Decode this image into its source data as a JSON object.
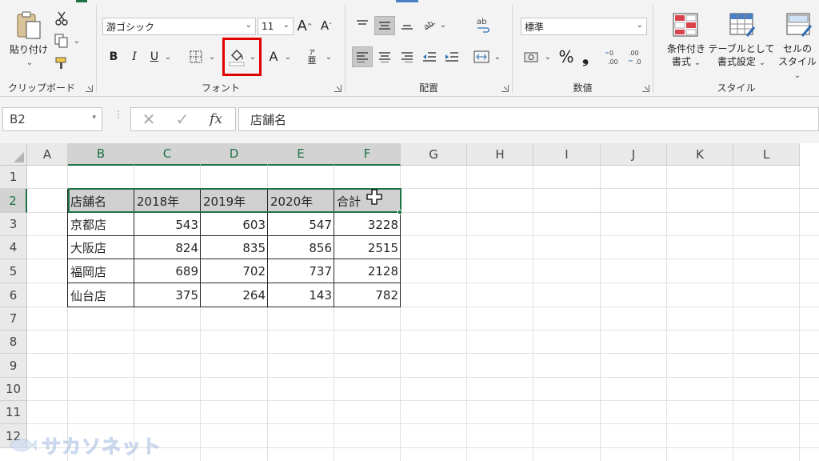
{
  "ribbon": {
    "clipboard": {
      "label": "クリップボード",
      "paste_label": "貼り付け"
    },
    "font": {
      "label": "フォント",
      "font_name": "游ゴシック",
      "font_size": "11",
      "bold": "B",
      "italic": "I",
      "underline": "U",
      "font_color": "A",
      "phonetic_top": "ア",
      "phonetic_bottom": "亜",
      "grow": "A",
      "shrink": "A",
      "highlight_color": "#e00000"
    },
    "alignment": {
      "label": "配置"
    },
    "number": {
      "label": "数値",
      "format": "標準",
      "percent": "%",
      "comma": "❟"
    },
    "styles": {
      "label": "スタイル",
      "conditional_line1": "条件付き",
      "conditional_line2": "書式",
      "table_line1": "テーブルとして",
      "table_line2": "書式設定",
      "cell_line1": "セルの",
      "cell_line2": "スタイル"
    }
  },
  "formula_bar": {
    "name_box": "B2",
    "fx": "fx",
    "content": "店舗名"
  },
  "grid": {
    "columns": [
      "A",
      "B",
      "C",
      "D",
      "E",
      "F",
      "G",
      "H",
      "I",
      "J",
      "K",
      "L"
    ],
    "rows": [
      "1",
      "2",
      "3",
      "4",
      "5",
      "6",
      "7",
      "8",
      "9",
      "10",
      "11",
      "12"
    ],
    "table": {
      "header": [
        "店舗名",
        "2018年",
        "2019年",
        "2020年",
        "合計"
      ],
      "rows": [
        [
          "京都店",
          "543",
          "603",
          "547",
          "3228"
        ],
        [
          "大阪店",
          "824",
          "835",
          "856",
          "2515"
        ],
        [
          "福岡店",
          "689",
          "702",
          "737",
          "2128"
        ],
        [
          "仙台店",
          "375",
          "264",
          "143",
          "782"
        ]
      ]
    }
  },
  "watermark": "サカソネット",
  "colors": {
    "excel_green": "#217346",
    "highlight_red": "#e00000",
    "selection_fill": "#d0d0d0"
  }
}
